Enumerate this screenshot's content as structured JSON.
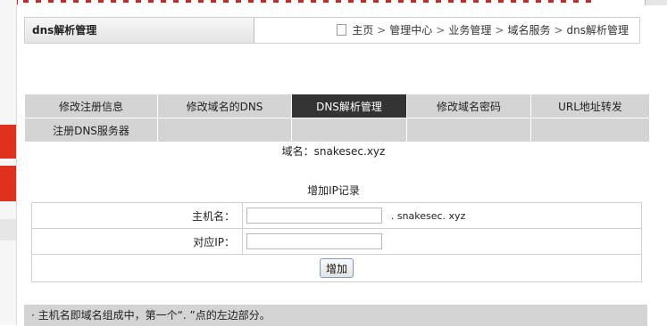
{
  "header": {
    "title": "dns解析管理",
    "breadcrumb": [
      "主页",
      "管理中心",
      "业务管理",
      "域名服务",
      "dns解析管理"
    ]
  },
  "tabs": {
    "row1": [
      "修改注册信息",
      "修改域名的DNS",
      "DNS解析管理",
      "修改域名密码",
      "URL地址转发"
    ],
    "row2": [
      "注册DNS服务器",
      "",
      "",
      "",
      ""
    ],
    "active": "DNS解析管理"
  },
  "domain": {
    "label": "域名：",
    "value": "snakesec.xyz"
  },
  "form": {
    "title": "增加IP记录",
    "host_label": "主机名：",
    "host_value": "",
    "host_suffix": ". snakesec. xyz",
    "ip_label": "对应IP：",
    "ip_value": "",
    "submit_label": "增加"
  },
  "note": {
    "text": "· 主机名即域名组成中，第一个“. ”点的左边部分。"
  },
  "colors": {
    "accent_red": "#e0301e",
    "tab_active": "#333333",
    "tab_bg": "#d4d4d4"
  }
}
